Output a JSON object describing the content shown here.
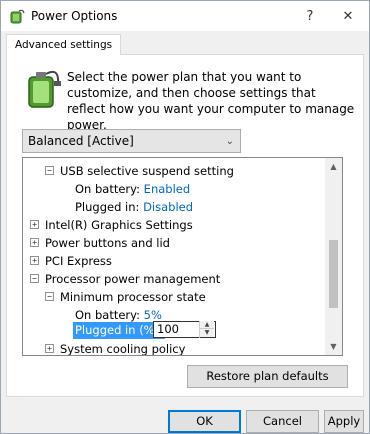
{
  "window": {
    "title": "Power Options",
    "help_label": "?",
    "close_label": "✕"
  },
  "tab": {
    "label": "Advanced settings"
  },
  "description": "Select the power plan that you want to customize, and then choose settings that reflect how you want your computer to manage power.",
  "plan_select": {
    "value": "Balanced [Active]"
  },
  "tree": {
    "usb_suspend": {
      "label": "USB selective suspend setting",
      "on_battery_label": "On battery:",
      "on_battery_value": "Enabled",
      "plugged_in_label": "Plugged in:",
      "plugged_in_value": "Disabled"
    },
    "intel_graphics": "Intel(R) Graphics Settings",
    "power_buttons": "Power buttons and lid",
    "pci_express": "PCI Express",
    "processor": {
      "label": "Processor power management",
      "min_state": {
        "label": "Minimum processor state",
        "on_battery_label": "On battery:",
        "on_battery_value": "5%",
        "plugged_in_label": "Plugged in (%):",
        "plugged_in_value": "100"
      }
    },
    "cooling": "System cooling policy"
  },
  "buttons": {
    "restore": "Restore plan defaults",
    "ok": "OK",
    "cancel": "Cancel",
    "apply": "Apply"
  },
  "colors": {
    "link": "#0066cc",
    "selection": "#3399ff"
  }
}
